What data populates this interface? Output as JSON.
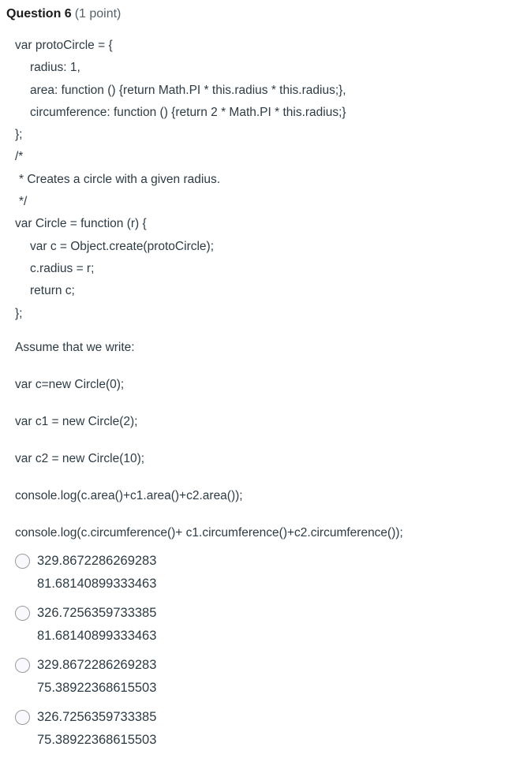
{
  "header": {
    "title": "Question 6",
    "points": "(1 point)"
  },
  "code": {
    "lines": [
      {
        "text": "var protoCircle = {",
        "indent": 0
      },
      {
        "text": "radius: 1,",
        "indent": 1
      },
      {
        "text": "area: function () {return Math.PI * this.radius * this.radius;},",
        "indent": 1
      },
      {
        "text": "circumference: function () {return 2 * Math.PI * this.radius;}",
        "indent": 1
      },
      {
        "text": "};",
        "indent": 0
      },
      {
        "text": "/*",
        "indent": 0
      },
      {
        "text": "* Creates a circle with a given radius.",
        "indent": 2
      },
      {
        "text": "*/",
        "indent": 2
      },
      {
        "text": "var Circle = function (r) {",
        "indent": 0
      },
      {
        "text": "var c = Object.create(protoCircle);",
        "indent": 1
      },
      {
        "text": "c.radius = r;",
        "indent": 1
      },
      {
        "text": "return c;",
        "indent": 1
      },
      {
        "text": "};",
        "indent": 0
      }
    ]
  },
  "prose": {
    "assume": "Assume that we write:",
    "statements": [
      "var c=new Circle(0);",
      "var c1 = new Circle(2);",
      "var c2 = new Circle(10);",
      "console.log(c.area()+c1.area()+c2.area());",
      "console.log(c.circumference()+ c1.circumference()+c2.circumference());"
    ]
  },
  "answers": [
    {
      "line1": "329.8672286269283",
      "line2": "81.68140899333463",
      "selected": false
    },
    {
      "line1": "326.7256359733385",
      "line2": "81.68140899333463",
      "selected": false
    },
    {
      "line1": "329.8672286269283",
      "line2": "75.38922368615503",
      "selected": false
    },
    {
      "line1": "326.7256359733385",
      "line2": "75.38922368615503",
      "selected": false
    }
  ],
  "colors": {
    "background": "#ffffff",
    "text": "#2d3b45",
    "title": "#1b1b1b",
    "points": "#55616b",
    "radio_border": "#9b9b9e",
    "radio_fill": "#f9f9fd"
  }
}
